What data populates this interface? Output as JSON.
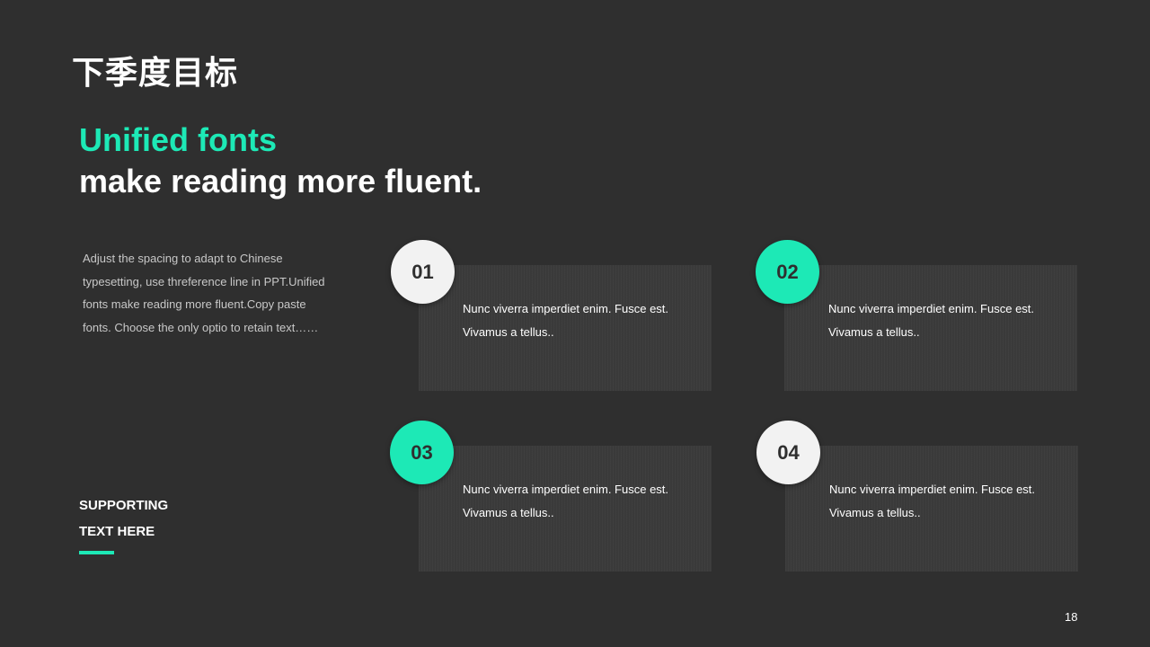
{
  "title": "下季度目标",
  "headline": {
    "line1": "Unified fonts",
    "line2": "make reading more fluent."
  },
  "intro_text": "Adjust the spacing to adapt to Chinese typesetting, use threference line in PPT.Unified fonts make reading more fluent.Copy paste fonts. Choose the only optio to retain text……",
  "supporting": {
    "line1": "SUPPORTING",
    "line2": "TEXT HERE"
  },
  "cards": [
    {
      "number": "01",
      "text": "Nunc  viverra imperdiet  enim.  Fusce est. Vivamus  a tellus.."
    },
    {
      "number": "02",
      "text": "Nunc  viverra imperdiet  enim.  Fusce est. Vivamus  a tellus.."
    },
    {
      "number": "03",
      "text": "Nunc  viverra imperdiet  enim.  Fusce est. Vivamus  a tellus.."
    },
    {
      "number": "04",
      "text": "Nunc  viverra imperdiet  enim.  Fusce est. Vivamus  a tellus.."
    }
  ],
  "page_number": "18",
  "colors": {
    "background": "#2f2f2f",
    "accent": "#1de9b6",
    "card": "#3a3a3a",
    "badge_light": "#f2f2f2"
  }
}
